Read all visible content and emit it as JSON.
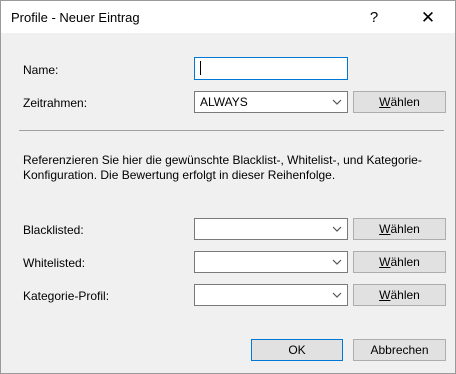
{
  "window": {
    "title": "Profile - Neuer Eintrag",
    "help_symbol": "?",
    "close_symbol": "✕"
  },
  "form": {
    "name_label": "Name:",
    "name_value": "",
    "zeitrahmen_label": "Zeitrahmen:",
    "zeitrahmen_value": "ALWAYS",
    "info_text": "Referenzieren Sie hier die gewünschte Blacklist-, Whitelist-, und Kategorie-Konfiguration. Die Bewertung erfolgt in dieser Reihenfolge.",
    "blacklisted_label": "Blacklisted:",
    "blacklisted_value": "",
    "whitelisted_label": "Whitelisted:",
    "whitelisted_value": "",
    "kategorie_label": "Kategorie-Profil:",
    "kategorie_value": ""
  },
  "buttons": {
    "choose_accel": "W",
    "choose_rest": "ählen",
    "ok": "OK",
    "cancel": "Abbrechen"
  },
  "icons": {
    "dropdown": "chevron-down-icon",
    "help": "help-icon",
    "close": "close-icon"
  }
}
